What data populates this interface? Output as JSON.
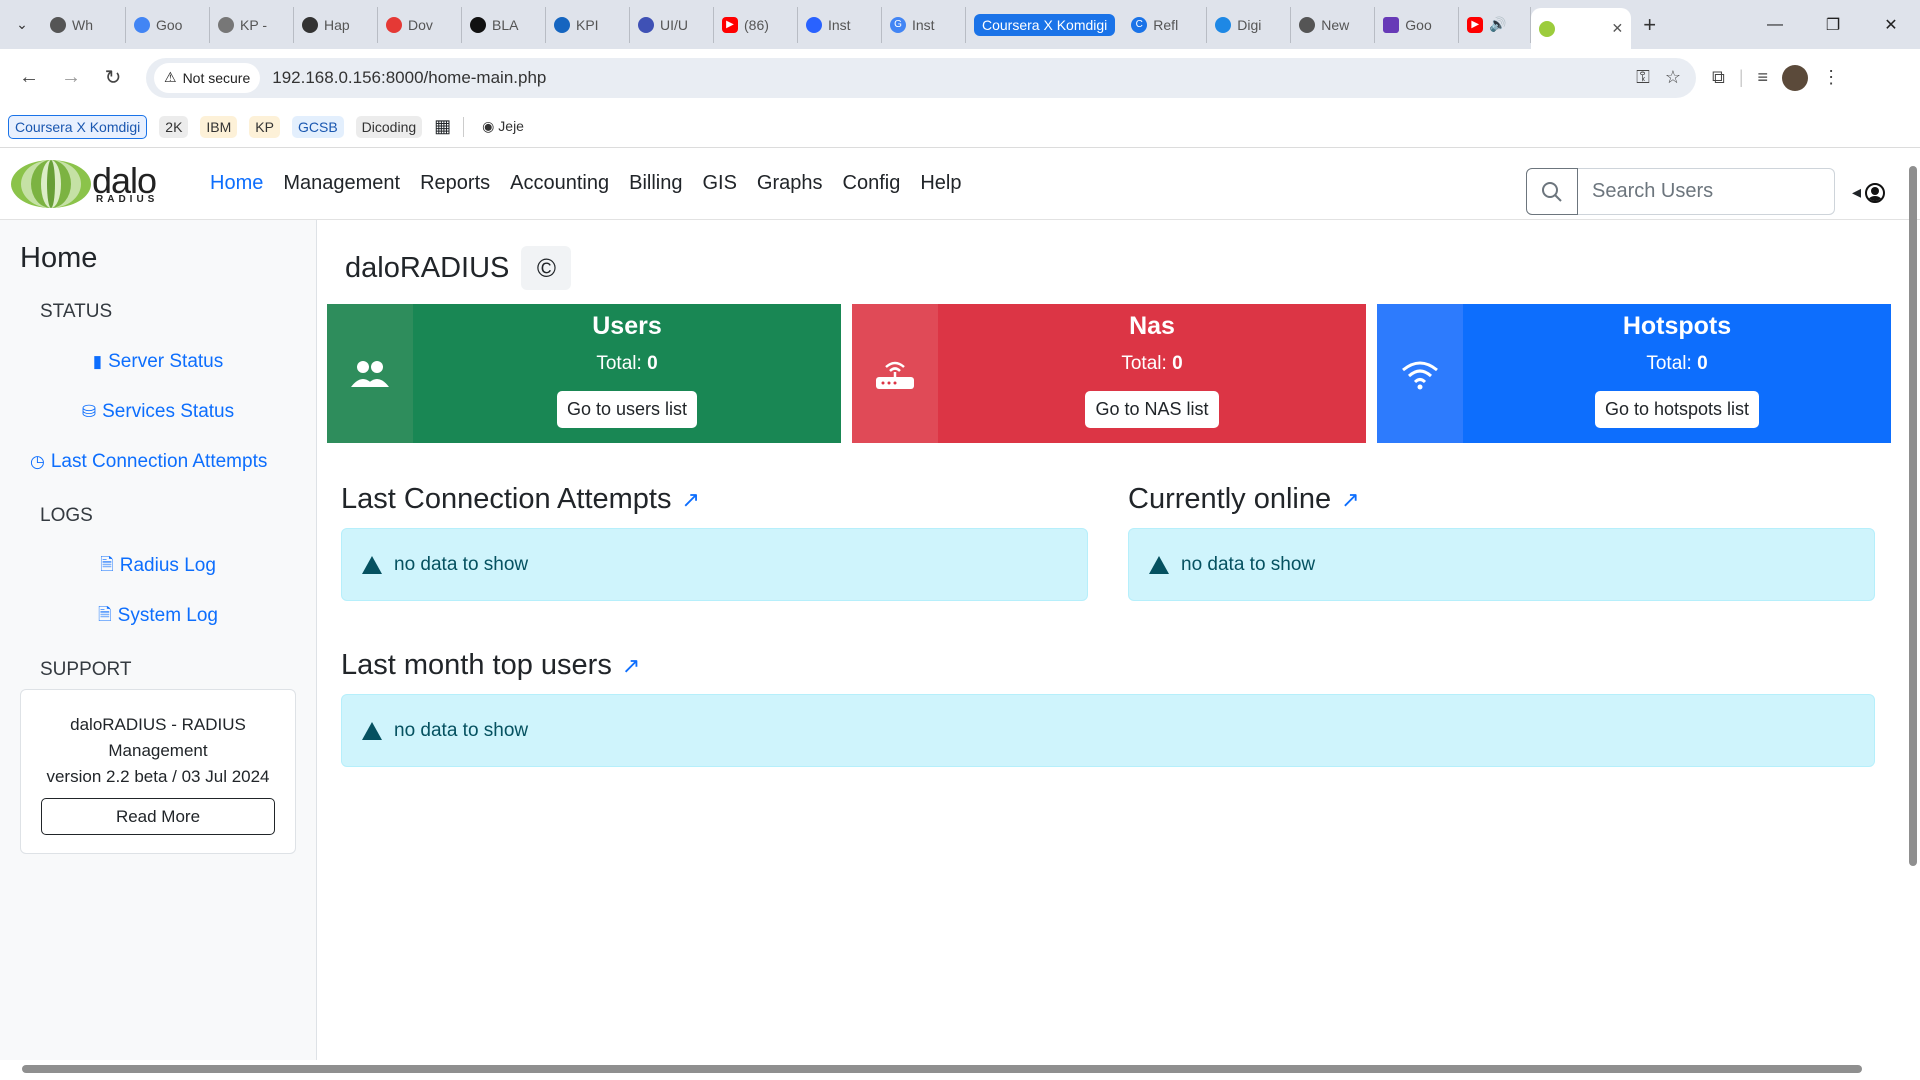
{
  "browser": {
    "tabs": [
      {
        "label": "Wh",
        "color": "#555"
      },
      {
        "label": "Goo",
        "color": "#4285f4"
      },
      {
        "label": "KP -",
        "color": "#777"
      },
      {
        "label": "Hap",
        "color": "#333"
      },
      {
        "label": "Dov",
        "color": "#e53935"
      },
      {
        "label": "BLA",
        "color": "#111"
      },
      {
        "label": "KPI",
        "color": "#1565c0"
      },
      {
        "label": "UI/U",
        "color": "#3f51b5"
      },
      {
        "label": "(86)",
        "color": "#ff0000"
      },
      {
        "label": "Inst",
        "color": "#2962ff"
      },
      {
        "label": "Inst",
        "color": "#4285f4"
      }
    ],
    "group_label": "Coursera X Komdigi",
    "tabs2": [
      {
        "label": "Refl",
        "color": "#1a73e8"
      },
      {
        "label": "Digi",
        "color": "#1e88e5"
      },
      {
        "label": "New",
        "color": "#555"
      },
      {
        "label": "Goo",
        "color": "#673ab7"
      }
    ],
    "not_secure": "Not secure",
    "url": "192.168.0.156:8000/home-main.php",
    "bookmarks": [
      "Coursera X Komdigi",
      "2K",
      "IBM",
      "KP",
      "GCSB",
      "Dicoding",
      "Jeje"
    ]
  },
  "app": {
    "logo_main": "dalo",
    "logo_sub": "RADIUS",
    "menu": [
      "Home",
      "Management",
      "Reports",
      "Accounting",
      "Billing",
      "GIS",
      "Graphs",
      "Config",
      "Help"
    ],
    "search_placeholder": "Search Users"
  },
  "sidebar": {
    "title": "Home",
    "status_label": "STATUS",
    "status_items": [
      "Server Status",
      "Services Status",
      "Last Connection Attempts"
    ],
    "logs_label": "LOGS",
    "log_items": [
      "Radius Log",
      "System Log"
    ],
    "support_label": "SUPPORT",
    "support_line1": "daloRADIUS - RADIUS Management",
    "support_line2": "version 2.2 beta / 03 Jul 2024",
    "read_more": "Read More"
  },
  "main": {
    "title": "daloRADIUS",
    "cards": [
      {
        "title": "Users",
        "total_label": "Total:",
        "total": "0",
        "button": "Go to users list"
      },
      {
        "title": "Nas",
        "total_label": "Total:",
        "total": "0",
        "button": "Go to NAS list"
      },
      {
        "title": "Hotspots",
        "total_label": "Total:",
        "total": "0",
        "button": "Go to hotspots list"
      }
    ],
    "panels": [
      {
        "title": "Last Connection Attempts",
        "message": "no data to show"
      },
      {
        "title": "Currently online",
        "message": "no data to show"
      },
      {
        "title": "Last month top users",
        "message": "no data to show"
      }
    ]
  }
}
